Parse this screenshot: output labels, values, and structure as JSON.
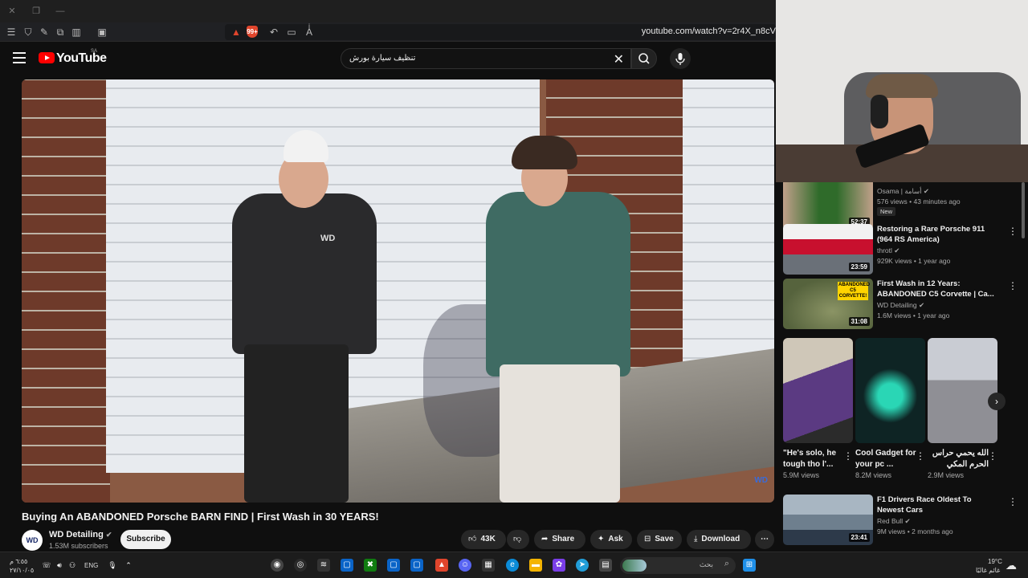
{
  "browser": {
    "url": "youtube.com/watch?v=2r4X_n8cV",
    "shield_count": "99+"
  },
  "header": {
    "logo_text": "YouTube",
    "country": "SA",
    "search_value": "تنظيف سيارة بورش"
  },
  "video": {
    "title": "Buying An ABANDONED Porsche BARN FIND | First Wash in 30 YEARS!",
    "watermark": "WD",
    "channel": {
      "avatar_text": "WD",
      "name": "WD Detailing",
      "subscribers": "1.53M subscribers",
      "subscribe_label": "Subscribe"
    },
    "actions": {
      "likes": "43K",
      "share": "Share",
      "ask": "Ask",
      "save": "Save",
      "download": "Download"
    }
  },
  "recommendations": [
    {
      "title": "",
      "channel": "Osama | أسامة",
      "meta": "576 views • 43 minutes ago",
      "duration": "52:37",
      "badge": "New",
      "thumb_color": "#2f6b2a"
    },
    {
      "title": "Restoring a Rare Porsche 911 (964 RS America)",
      "channel": "throtl",
      "meta": "929K views • 1 year ago",
      "duration": "23:59",
      "thumb_color": "#9aa3ad"
    },
    {
      "title": "First Wash in 12 Years: ABANDONED C5 Corvette | Ca...",
      "channel": "WD Detailing",
      "meta": "1.6M views • 1 year ago",
      "duration": "31:08",
      "thumb_label": "ABANDONED C5 CORVETTE!",
      "thumb_color": "#56633d"
    },
    {
      "title": "F1 Drivers Race Oldest To Newest Cars",
      "channel": "Red Bull",
      "meta": "9M views • 2 months ago",
      "duration": "23:41",
      "thumb_color": "#6e7f8e"
    }
  ],
  "shorts": [
    {
      "title": "\"He's solo, he tough tho l'...",
      "views": "5.9M views",
      "color": "#5b3a82"
    },
    {
      "title": "Cool Gadget for your pc ...",
      "views": "8.2M views",
      "color": "#0e2424"
    },
    {
      "title": "الله يحمي حراس الحرم المكي قمة...",
      "views": "2.9M views",
      "color": "#8f8f95"
    }
  ],
  "taskbar": {
    "time": "٦:٥٥ م",
    "date": "٢٧/١٠/٠٥",
    "lang": "ENG",
    "search_placeholder": "بحث",
    "temp": "19°C",
    "weather": "غائم غالبًا"
  },
  "colors": {
    "background": "#0f0f0f",
    "youtube_red": "#ff0000",
    "pill": "#272727"
  }
}
